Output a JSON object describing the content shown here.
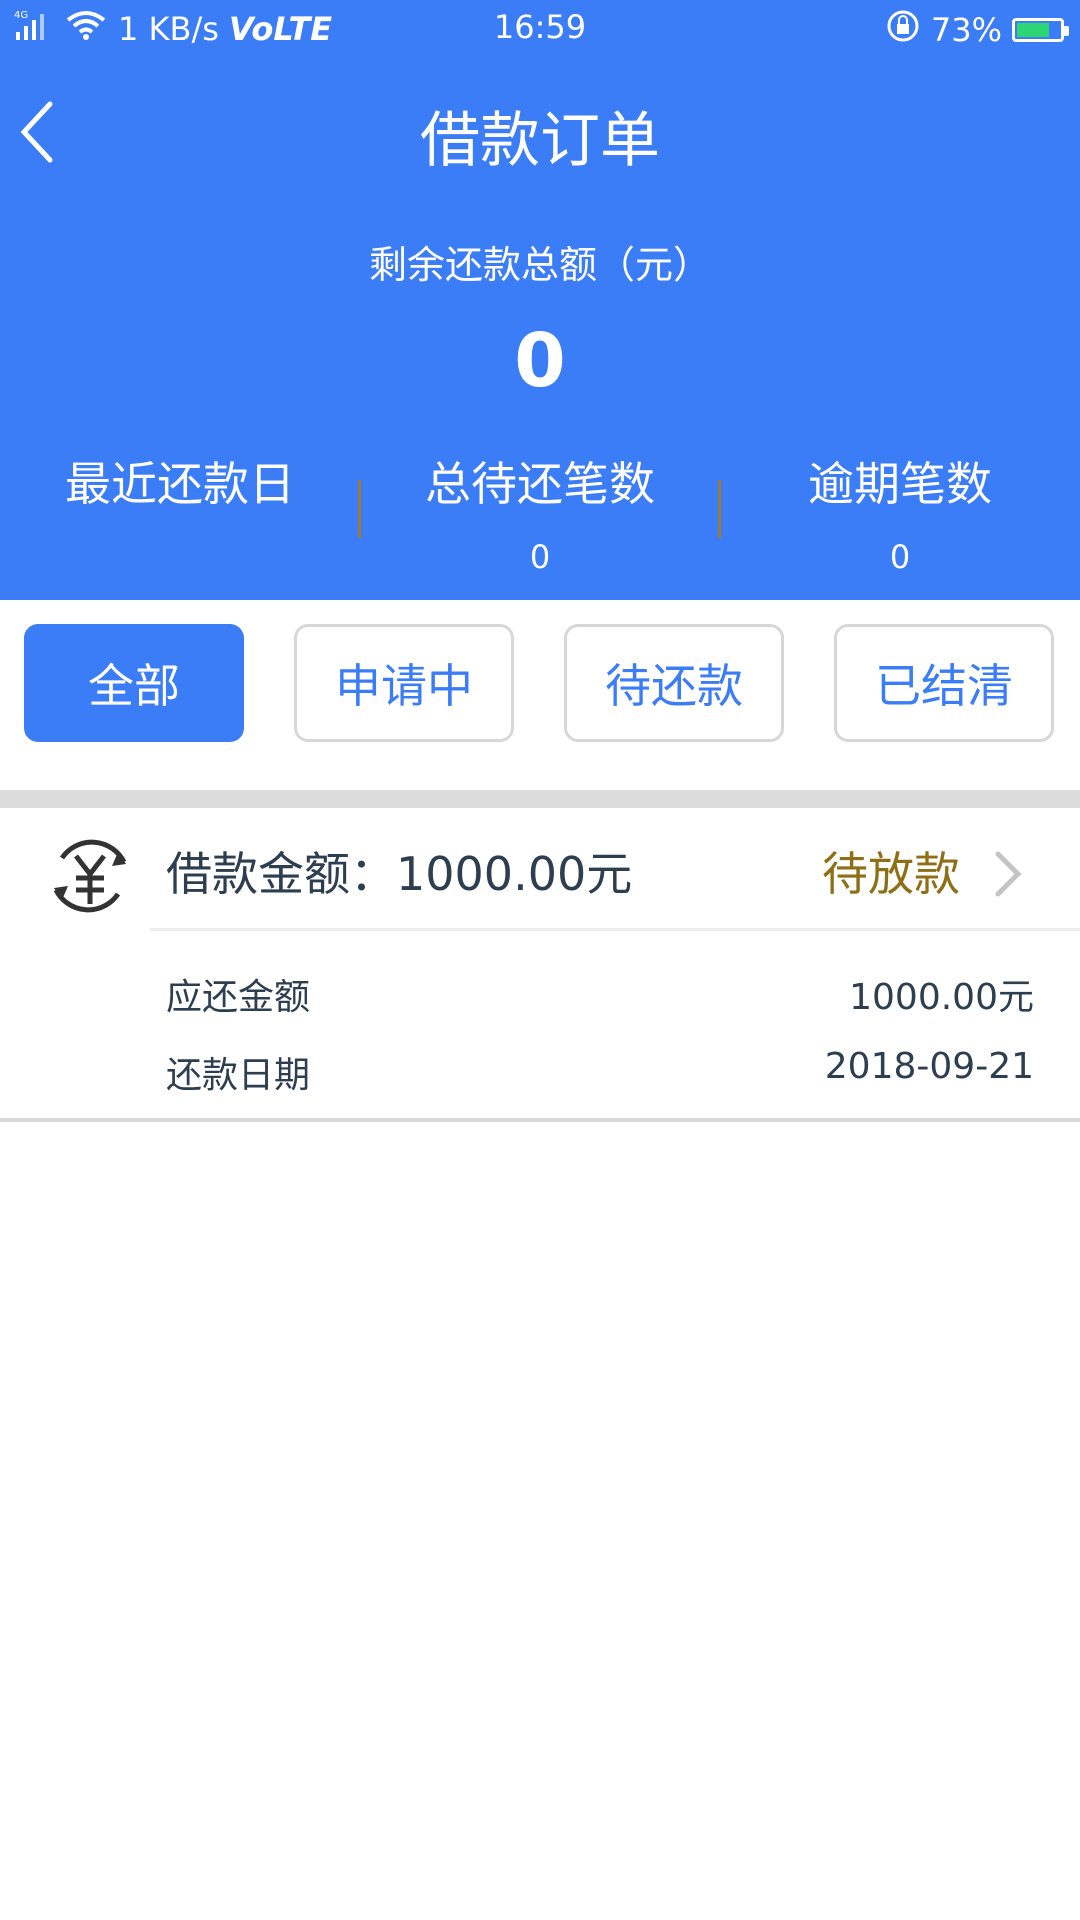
{
  "status_bar": {
    "network": "4G",
    "speed": "1 KB/s",
    "volte": "VoLTE",
    "time": "16:59",
    "battery": "73%"
  },
  "header": {
    "title": "借款订单",
    "summary_label": "剩余还款总额（元）",
    "summary_value": "0",
    "stats": [
      {
        "label": "最近还款日",
        "value": ""
      },
      {
        "label": "总待还笔数",
        "value": "0"
      },
      {
        "label": "逾期笔数",
        "value": "0"
      }
    ]
  },
  "filters": [
    {
      "label": "全部",
      "active": true
    },
    {
      "label": "申请中",
      "active": false
    },
    {
      "label": "待还款",
      "active": false
    },
    {
      "label": "已结清",
      "active": false
    }
  ],
  "order": {
    "title": "借款金额：1000.00元",
    "status": "待放款",
    "rows": [
      {
        "label": "应还金额",
        "value": "1000.00元"
      },
      {
        "label": "还款日期",
        "value": "2018-09-21"
      }
    ]
  },
  "colors": {
    "primary": "#3b7cf7",
    "status": "#8f6f16",
    "text": "#2c3e50"
  }
}
